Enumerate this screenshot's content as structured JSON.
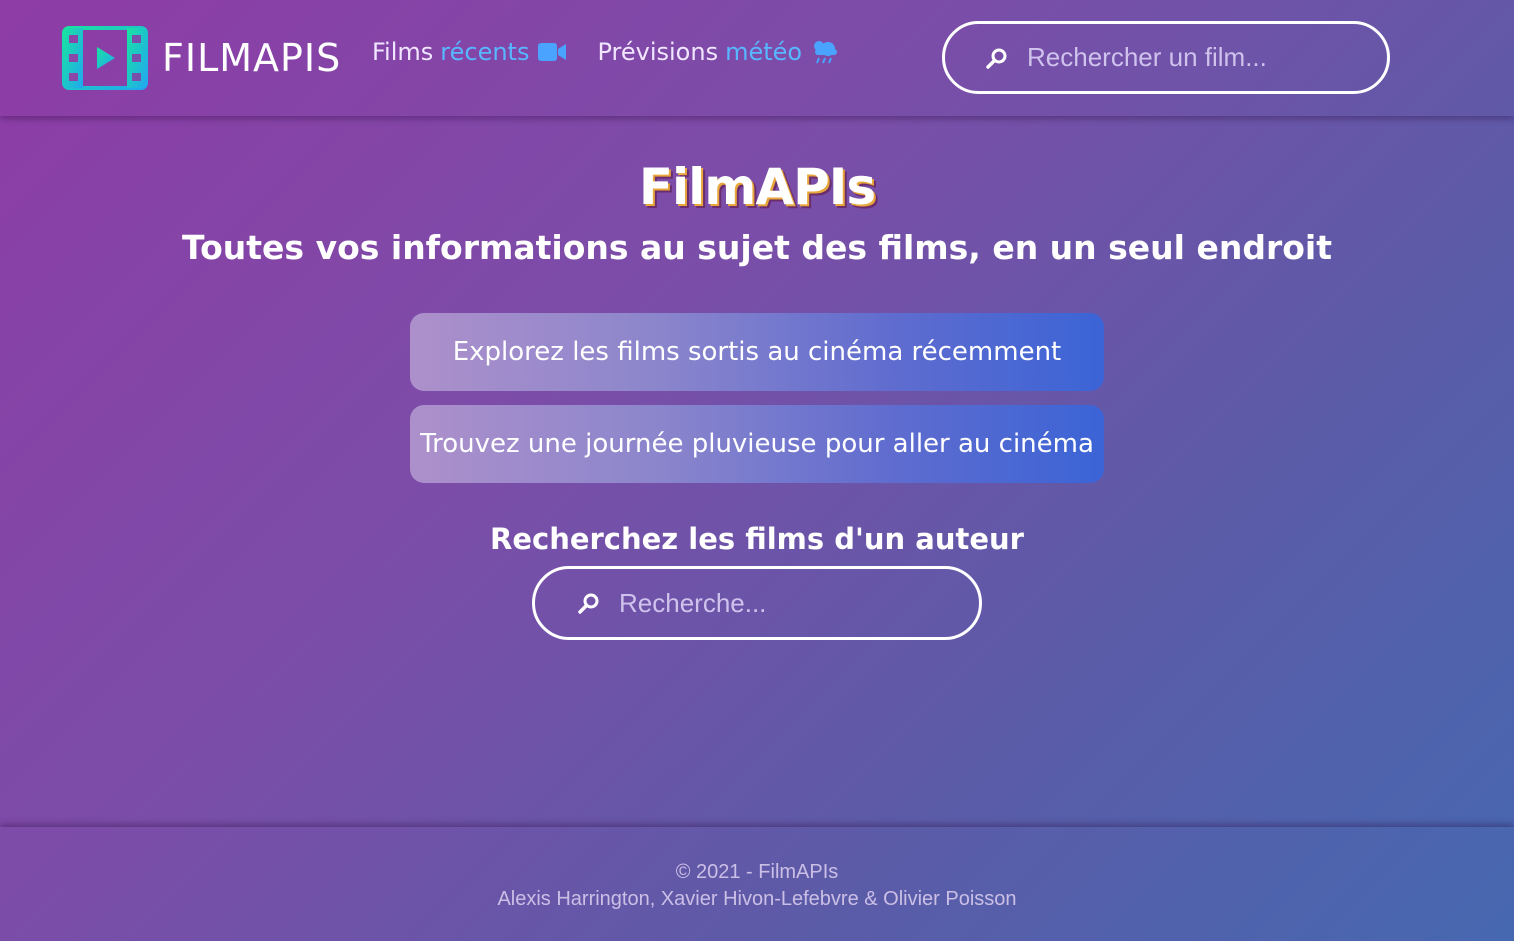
{
  "header": {
    "logo_text": "FILMAPIS",
    "logo_icon": "film-play-icon",
    "nav": [
      {
        "label_main": "Films",
        "label_accent": "récents",
        "icon": "video-camera-icon"
      },
      {
        "label_main": "Prévisions",
        "label_accent": "météo",
        "icon": "rain-cloud-icon"
      }
    ],
    "search": {
      "placeholder": "Rechercher un film...",
      "icon": "search-icon"
    }
  },
  "main": {
    "title": "FilmAPIs",
    "subtitle": "Toutes vos informations au sujet des films, en un seul endroit",
    "buttons": [
      {
        "label": "Explorez les films sortis au cinéma récemment"
      },
      {
        "label": "Trouvez une journée pluvieuse pour aller au cinéma"
      }
    ],
    "author_search": {
      "title": "Recherchez les films d'un auteur",
      "placeholder": "Recherche...",
      "icon": "search-icon"
    }
  },
  "footer": {
    "copyright": "© 2021 - FilmAPIs",
    "authors": "Alexis Harrington, Xavier Hivon-Lefebvre & Olivier Poisson"
  },
  "colors": {
    "accent_blue": "#58b7ff",
    "logo_gradient_start": "#19e3a0",
    "logo_gradient_end": "#21a8f0",
    "button_gradient_start": "#ad90cb",
    "button_gradient_end": "#3b64d6"
  }
}
